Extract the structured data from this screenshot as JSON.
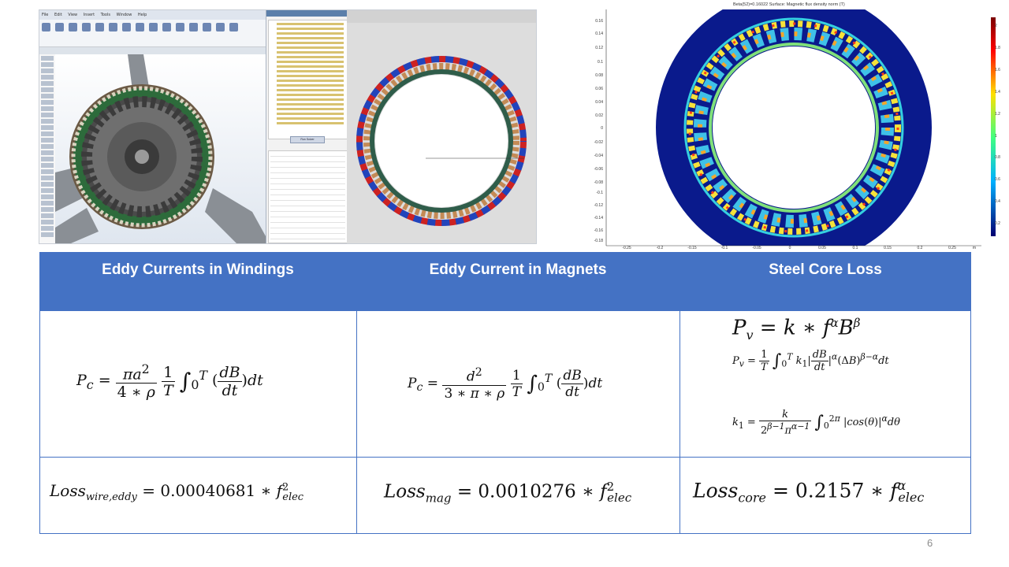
{
  "cad_screenshot": {
    "menu": [
      "File",
      "Edit",
      "View",
      "Insert",
      "Tools",
      "Window",
      "Help"
    ],
    "right_panel_button": "Run Solver"
  },
  "comsol_plot": {
    "title": "Beta(52)=0.16022  Surface: Magnetic flux density norm (T)",
    "y_ticks": [
      "0.16",
      "0.14",
      "0.12",
      "0.1",
      "0.08",
      "0.06",
      "0.04",
      "0.02",
      "0",
      "-0.02",
      "-0.04",
      "-0.06",
      "-0.08",
      "-0.1",
      "-0.12",
      "-0.14",
      "-0.16",
      "-0.18"
    ],
    "x_ticks": [
      "-0.25",
      "-0.2",
      "-0.15",
      "-0.1",
      "-0.05",
      "0",
      "0.05",
      "0.1",
      "0.15",
      "0.2",
      "0.25"
    ],
    "x_unit": "m",
    "colorbar_ticks": [
      "2",
      "1.8",
      "1.6",
      "1.4",
      "1.2",
      "1",
      "0.8",
      "0.6",
      "0.4",
      "0.2"
    ],
    "colors": {
      "background": "#0a1a8c",
      "hot": "#ff3b1a",
      "cold": "#0a1a8c"
    }
  },
  "table": {
    "headers": [
      "Eddy Currents in Windings",
      "Eddy Current in Magnets",
      "Steel Core Loss"
    ],
    "header_color": "#4472c4",
    "losses": {
      "wire": {
        "base": "Loss",
        "sub": "wire,eddy",
        "coef": "0.00040681",
        "var": "f",
        "var_sub": "elec",
        "exp": "2"
      },
      "mag": {
        "base": "Loss",
        "sub": "mag",
        "coef": "0.0010276",
        "var": "f",
        "var_sub": "elec",
        "exp": "2"
      },
      "core": {
        "base": "Loss",
        "sub": "core",
        "coef": "0.2157",
        "var": "f",
        "var_sub": "elec",
        "exp": "α"
      }
    }
  },
  "page_number": "6"
}
